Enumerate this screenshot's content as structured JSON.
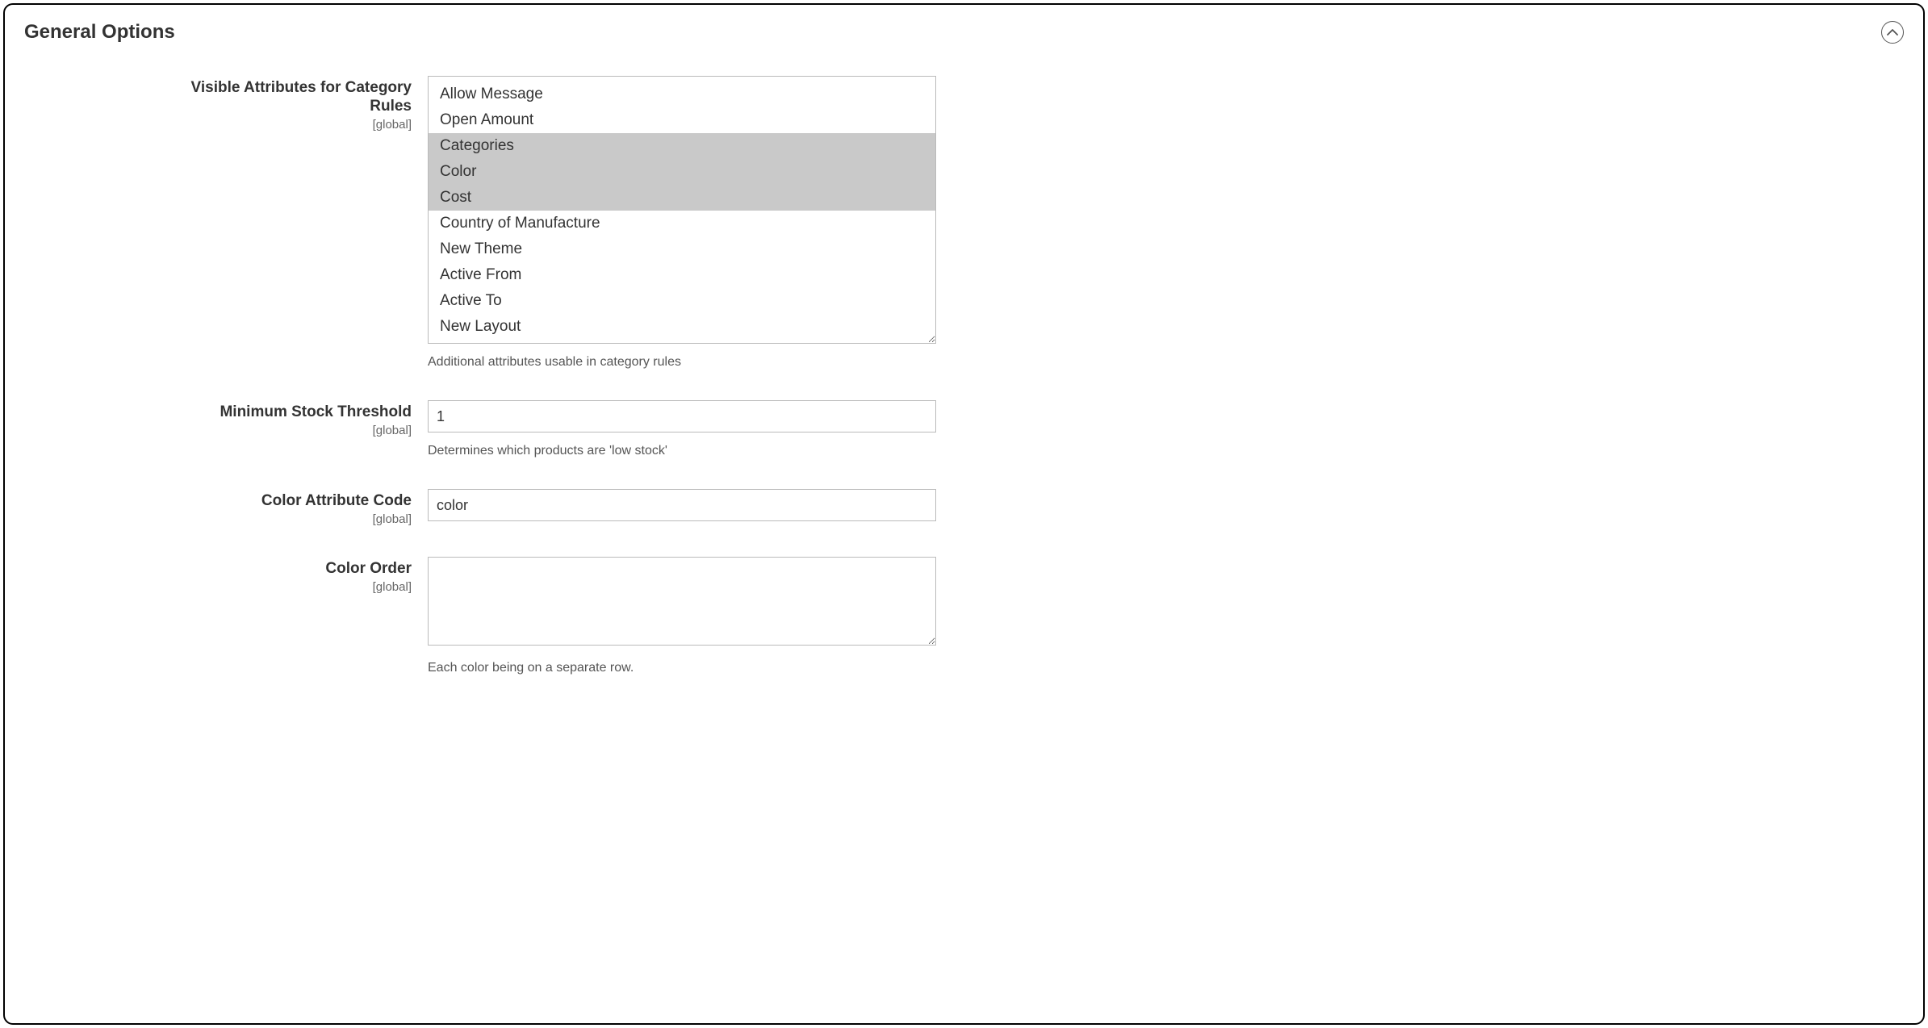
{
  "panel": {
    "title": "General Options"
  },
  "fields": {
    "visible_attributes": {
      "label": "Visible Attributes for Category Rules",
      "scope": "[global]",
      "help": "Additional attributes usable in category rules",
      "options": [
        {
          "label": "Allow Message",
          "selected": false
        },
        {
          "label": "Open Amount",
          "selected": false
        },
        {
          "label": "Categories",
          "selected": true
        },
        {
          "label": "Color",
          "selected": true
        },
        {
          "label": "Cost",
          "selected": true
        },
        {
          "label": "Country of Manufacture",
          "selected": false
        },
        {
          "label": "New Theme",
          "selected": false
        },
        {
          "label": "Active From",
          "selected": false
        },
        {
          "label": "Active To",
          "selected": false
        },
        {
          "label": "New Layout",
          "selected": false
        }
      ]
    },
    "min_stock": {
      "label": "Minimum Stock Threshold",
      "scope": "[global]",
      "value": "1",
      "help": "Determines which products are 'low stock'"
    },
    "color_attr": {
      "label": "Color Attribute Code",
      "scope": "[global]",
      "value": "color"
    },
    "color_order": {
      "label": "Color Order",
      "scope": "[global]",
      "value": "",
      "help": "Each color being on a separate row."
    }
  }
}
